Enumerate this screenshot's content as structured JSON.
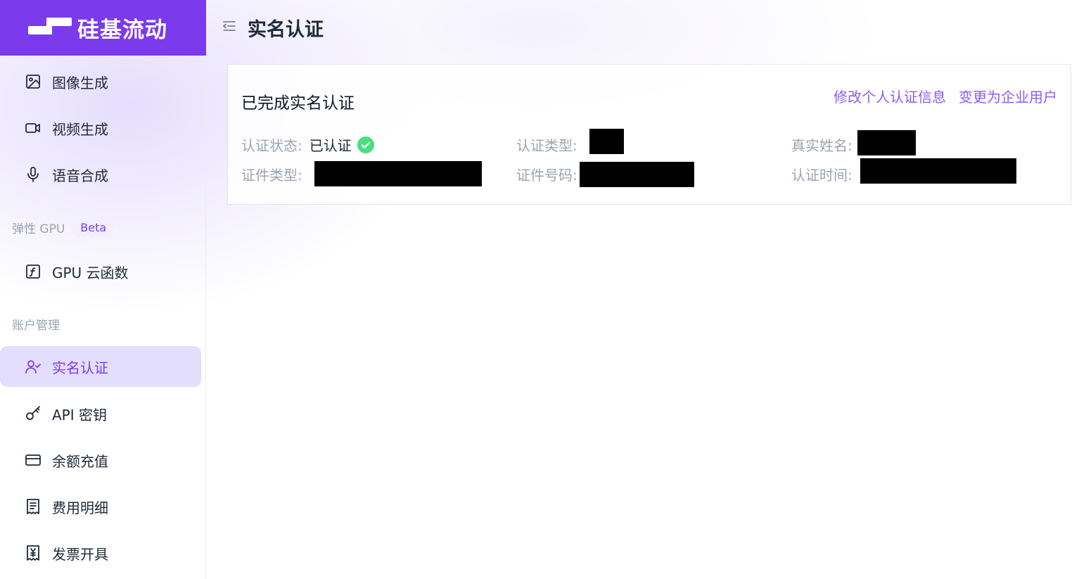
{
  "brand": {
    "name": "硅基流动",
    "color": "#7c3aed"
  },
  "sidebar": {
    "items_top": [
      {
        "label": "图像生成",
        "icon": "image-icon"
      },
      {
        "label": "视频生成",
        "icon": "video-icon"
      },
      {
        "label": "语音合成",
        "icon": "microphone-icon"
      }
    ],
    "section_gpu": {
      "label": "弹性 GPU",
      "badge": "Beta"
    },
    "items_gpu": [
      {
        "label": "GPU 云函数",
        "icon": "function-icon"
      }
    ],
    "section_account": {
      "label": "账户管理"
    },
    "items_account": [
      {
        "label": "实名认证",
        "icon": "user-check-icon",
        "active": true
      },
      {
        "label": "API 密钥",
        "icon": "key-icon"
      },
      {
        "label": "余额充值",
        "icon": "credit-card-icon"
      },
      {
        "label": "费用明细",
        "icon": "receipt-icon"
      },
      {
        "label": "发票开具",
        "icon": "invoice-icon"
      }
    ]
  },
  "header": {
    "title": "实名认证"
  },
  "card": {
    "title": "已完成实名认证",
    "links": {
      "edit": "修改个人认证信息",
      "switch": "变更为企业用户"
    },
    "fields": {
      "status_label": "认证状态:",
      "status_value": "已认证",
      "type_label": "认证类型:",
      "name_label": "真实姓名:",
      "id_type_label": "证件类型:",
      "id_number_label": "证件号码:",
      "time_label": "认证时间:"
    }
  },
  "colors": {
    "accent": "#7c3aed",
    "link": "#8b5cf6",
    "success": "#4ade80"
  }
}
